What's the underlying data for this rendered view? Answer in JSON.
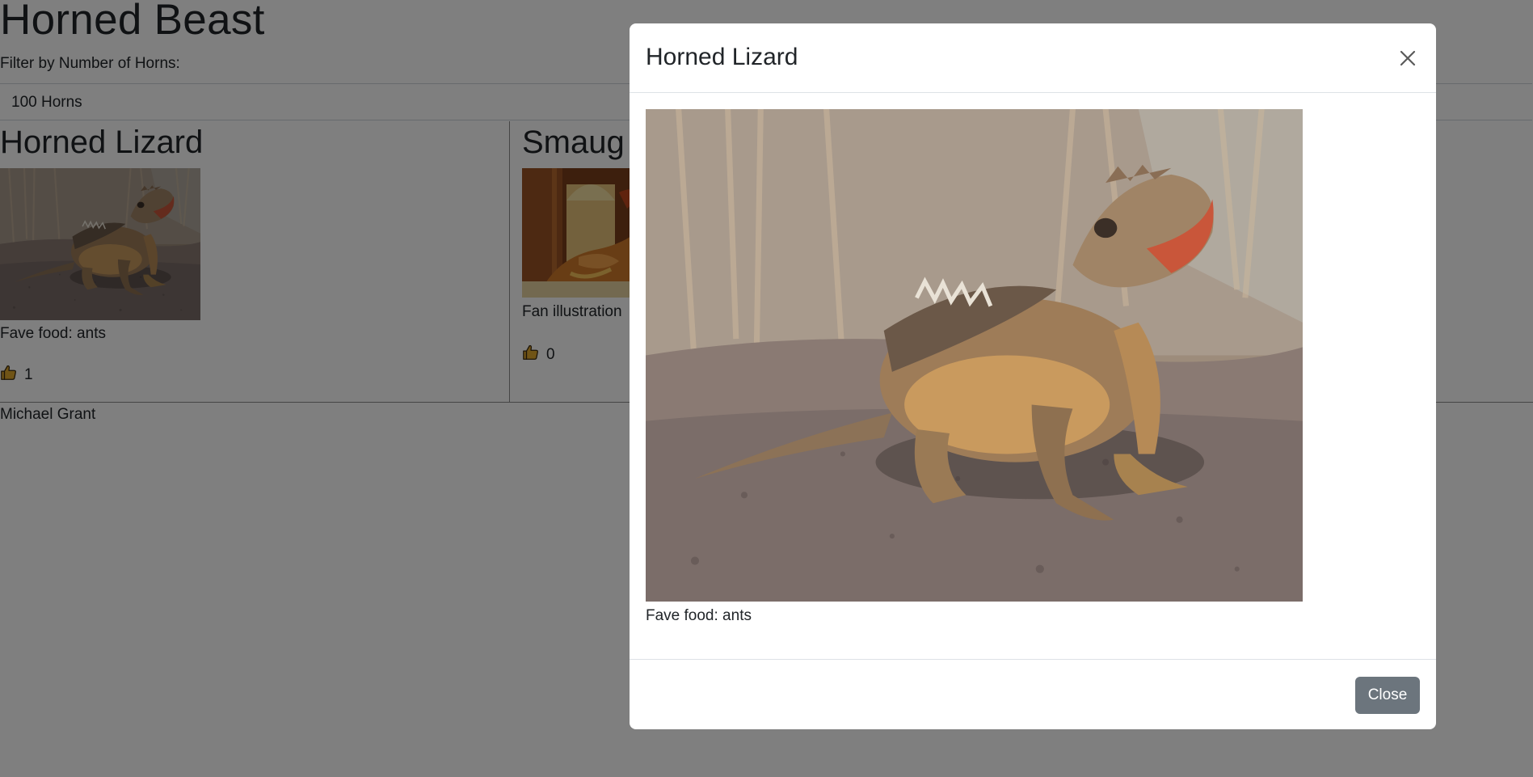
{
  "page": {
    "title": "Horned Beast",
    "filter_label": "Filter by Number of Horns:",
    "filter_selected": "100 Horns",
    "footer_author": "Michael Grant"
  },
  "cards": [
    {
      "title": "Horned Lizard",
      "description": "Fave food: ants",
      "likes": "1",
      "image": "horned-lizard-photo"
    },
    {
      "title": "Smaug",
      "description": "Fan illustration",
      "likes": "0",
      "image": "smaug-dragon-illustration"
    }
  ],
  "modal": {
    "title": "Horned Lizard",
    "description": "Fave food: ants",
    "close_label": "Close",
    "image": "horned-lizard-photo"
  },
  "icons": {
    "like": "thumbs-up-icon",
    "close": "close-x-icon"
  },
  "colors": {
    "backdrop": "rgba(0,0,0,0.5)",
    "close_button": "#6c757d",
    "thumb_icon": "#e1a82c"
  }
}
